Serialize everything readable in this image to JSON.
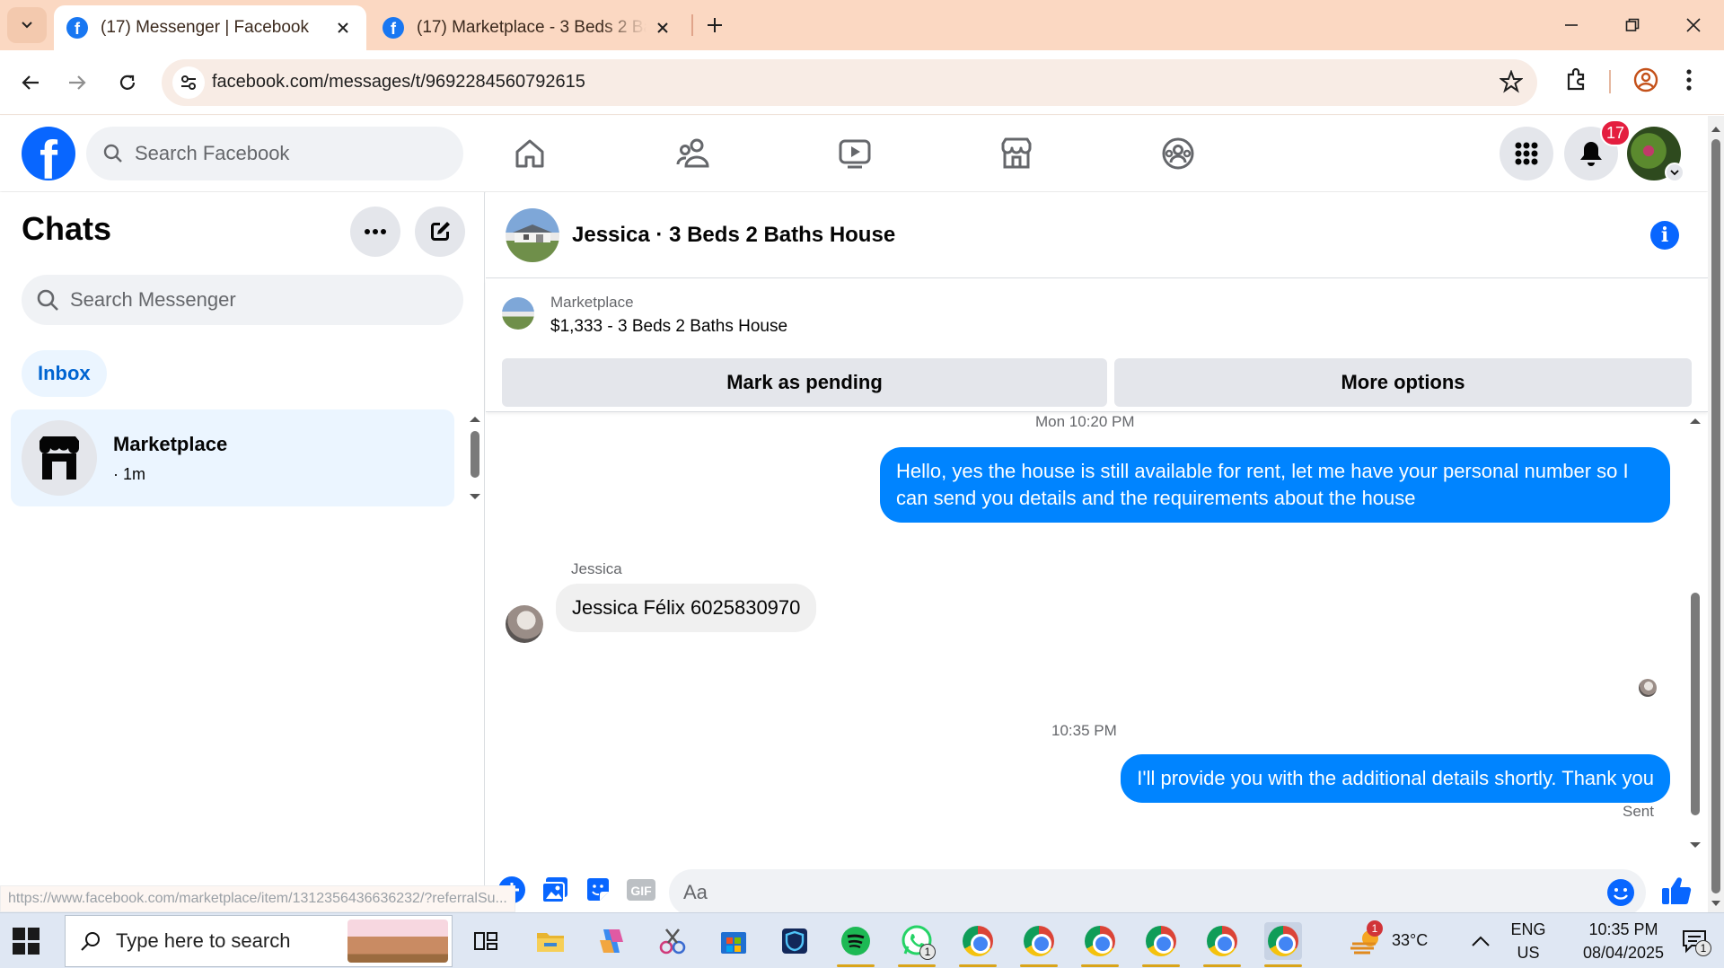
{
  "browser": {
    "tabs": [
      {
        "title": "(17) Messenger | Facebook",
        "active": true
      },
      {
        "title": "(17) Marketplace - 3 Beds 2 Baths House",
        "active": false
      }
    ],
    "url": "facebook.com/messages/t/9692284560792615",
    "status_url": "https://www.facebook.com/marketplace/item/1312356436636232/?referralSu..."
  },
  "fb": {
    "search_placeholder": "Search Facebook",
    "notification_count": "17",
    "logo_letter": "f"
  },
  "chats": {
    "title": "Chats",
    "search_placeholder": "Search Messenger",
    "filter": "Inbox",
    "items": [
      {
        "name": "Marketplace",
        "meta": "· 1m"
      }
    ]
  },
  "conversation": {
    "title": "Jessica · 3 Beds 2 Baths House",
    "marketplace_label": "Marketplace",
    "marketplace_item": "$1,333 - 3 Beds 2 Baths House",
    "mark_pending": "Mark as pending",
    "more_options": "More options",
    "messages": {
      "ts1": "Mon 10:20 PM",
      "out1": "Hello, yes the house is still available for rent, let me have your personal number so I can send you details and the requirements about the house",
      "sender_name": "Jessica",
      "in1": "Jessica Félix 6025830970",
      "ts2": "10:35 PM",
      "out2": "I'll provide you with the additional details shortly. Thank you",
      "status": "Sent"
    },
    "composer_placeholder": "Aa",
    "gif_label": "GIF"
  },
  "taskbar": {
    "search_placeholder": "Type here to search",
    "weather": "33°C",
    "weather_badge": "1",
    "lang_top": "ENG",
    "lang_bottom": "US",
    "time": "10:35 PM",
    "date": "08/04/2025",
    "whatsapp_badge": "1",
    "notif_badge": "1"
  },
  "colors": {
    "fb_blue": "#0866ff",
    "messenger_blue": "#0084ff",
    "chrome_tab_bg": "#fbd8c2"
  }
}
